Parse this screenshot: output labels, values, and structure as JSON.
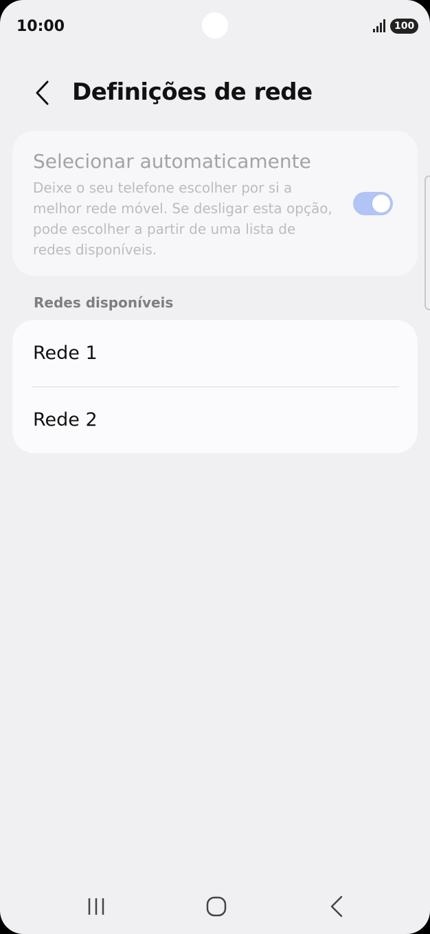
{
  "status_bar": {
    "time": "10:00",
    "battery": "100",
    "icons": [
      "signal-icon",
      "battery-icon"
    ]
  },
  "header": {
    "title": "Definições de rede",
    "back_icon": "chevron-left-icon"
  },
  "auto_select": {
    "title": "Selecionar automaticamente",
    "description": "Deixe o seu telefone escolher por si a melhor rede móvel. Se desligar esta opção, pode escolher a partir de uma lista de redes disponíveis.",
    "enabled": true,
    "toggle_color": "#b2c4f5"
  },
  "networks": {
    "section_label": "Redes disponíveis",
    "items": [
      {
        "label": "Rede 1"
      },
      {
        "label": "Rede 2"
      }
    ]
  },
  "navigation_bar": {
    "buttons": [
      "recent-apps-icon",
      "home-icon",
      "back-icon"
    ]
  },
  "colors": {
    "background": "#f0f0f2",
    "card": "#fbfbfd",
    "text_primary": "#111111",
    "text_disabled": "#a3a3a7"
  }
}
